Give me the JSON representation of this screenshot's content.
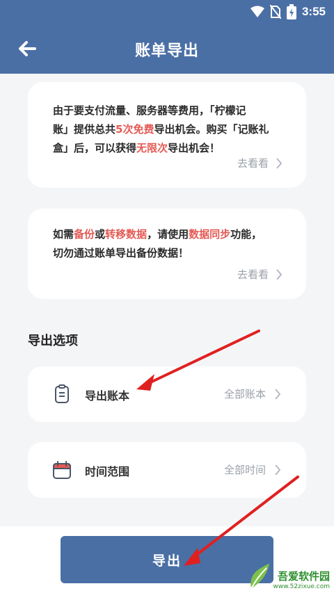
{
  "status_bar": {
    "time": "3:55"
  },
  "header": {
    "title": "账单导出"
  },
  "card1": {
    "line1_a": "由于要支付流量、服务器等费用，「柠檬记",
    "line2_a": "账」提供总共",
    "line2_hl": "5次免费",
    "line2_b": "导出机会。购买「记账礼",
    "line3_a": "盒」后，可以获得",
    "line3_hl": "无限次",
    "line3_b": "导出机会！",
    "link": "去看看"
  },
  "card2": {
    "line1_a": "如需",
    "line1_hl1": "备份",
    "line1_b": "或",
    "line1_hl2": "转移数据",
    "line1_c": "，请使用",
    "line1_hl3": "数据同步",
    "line1_d": "功能，",
    "line2": "切勿通过账单导出备份数据！",
    "link": "去看看"
  },
  "options": {
    "section_title": "导出选项",
    "items": [
      {
        "label": "导出账本",
        "value": "全部账本",
        "icon": "clipboard-icon"
      },
      {
        "label": "时间范围",
        "value": "全部时间",
        "icon": "calendar-icon"
      }
    ]
  },
  "export_button": {
    "label": "导出"
  },
  "watermark": {
    "line1": "吾爱软件园",
    "line2": "www.52zixue.com"
  },
  "colors": {
    "primary": "#4a6fa5",
    "highlight": "#e45a55",
    "annotation_arrow": "#e02020"
  }
}
